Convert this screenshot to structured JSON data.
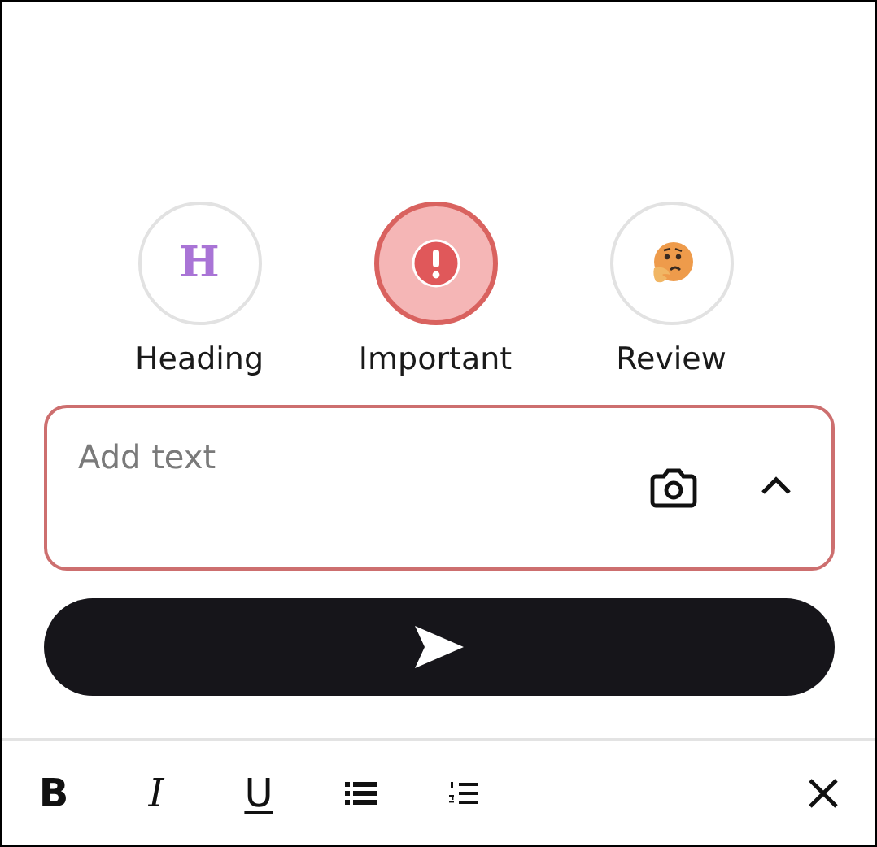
{
  "categories": [
    {
      "kind": "heading",
      "label": "Heading",
      "glyph": "H",
      "selected": false
    },
    {
      "kind": "important",
      "label": "Important",
      "selected": true
    },
    {
      "kind": "review",
      "label": "Review",
      "selected": false
    }
  ],
  "note_field": {
    "placeholder": "Add text"
  },
  "toolbar": [
    {
      "kind": "bold",
      "glyph": "B"
    },
    {
      "kind": "italic",
      "glyph": "I"
    },
    {
      "kind": "underline",
      "glyph": "U"
    },
    {
      "kind": "bullets"
    },
    {
      "kind": "numbers"
    }
  ]
}
